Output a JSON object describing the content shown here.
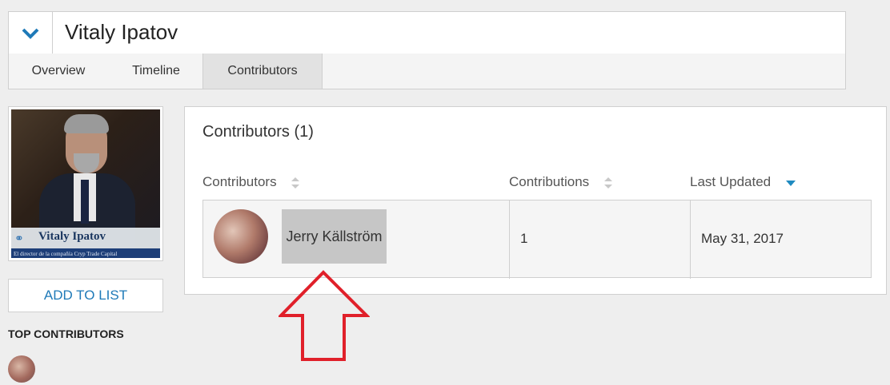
{
  "header": {
    "title": "Vitaly Ipatov",
    "toggle_icon": "chevron-down-icon"
  },
  "tabs": [
    {
      "label": "Overview"
    },
    {
      "label": "Timeline"
    },
    {
      "label": "Contributors",
      "active": true
    }
  ],
  "profile": {
    "photo_caption": "Vitaly Ipatov",
    "photo_subcaption": "El director de la compañía Cryp Trade Capital"
  },
  "sidebar": {
    "add_to_list_label": "ADD TO LIST",
    "top_contributors_label": "TOP CONTRIBUTORS"
  },
  "contributors_panel": {
    "title": "Contributors (1)",
    "columns": [
      "Contributors",
      "Contributions",
      "Last Updated"
    ],
    "rows": [
      {
        "name": "Jerry Källström",
        "contributions": "1",
        "last_updated": "May 31, 2017"
      }
    ]
  },
  "colors": {
    "accent": "#1f7ab8",
    "annotation_arrow": "#e0202a"
  }
}
